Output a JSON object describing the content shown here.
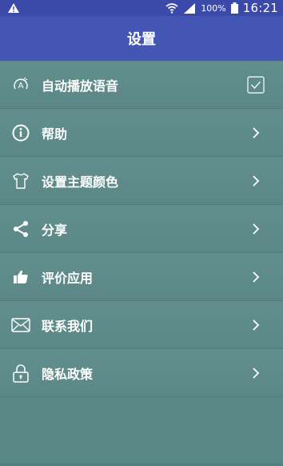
{
  "status_bar": {
    "battery": "100%",
    "time": "16:21"
  },
  "app_bar": {
    "title": "设置"
  },
  "menu": [
    {
      "label": "自动播放语音",
      "icon": "auto-play-voice-icon",
      "control": "checkbox"
    },
    {
      "label": "帮助",
      "icon": "info-icon",
      "control": "chevron"
    },
    {
      "label": "设置主题颜色",
      "icon": "shirt-icon",
      "control": "chevron"
    },
    {
      "label": "分享",
      "icon": "share-icon",
      "control": "chevron"
    },
    {
      "label": "评价应用",
      "icon": "thumbs-up-icon",
      "control": "chevron"
    },
    {
      "label": "联系我们",
      "icon": "mail-icon",
      "control": "chevron"
    },
    {
      "label": "隐私政策",
      "icon": "lock-icon",
      "control": "chevron"
    }
  ],
  "colors": {
    "status_bar": "#3b4aa8",
    "app_bar": "#4356b3",
    "list_background": "#5f8c8a"
  }
}
